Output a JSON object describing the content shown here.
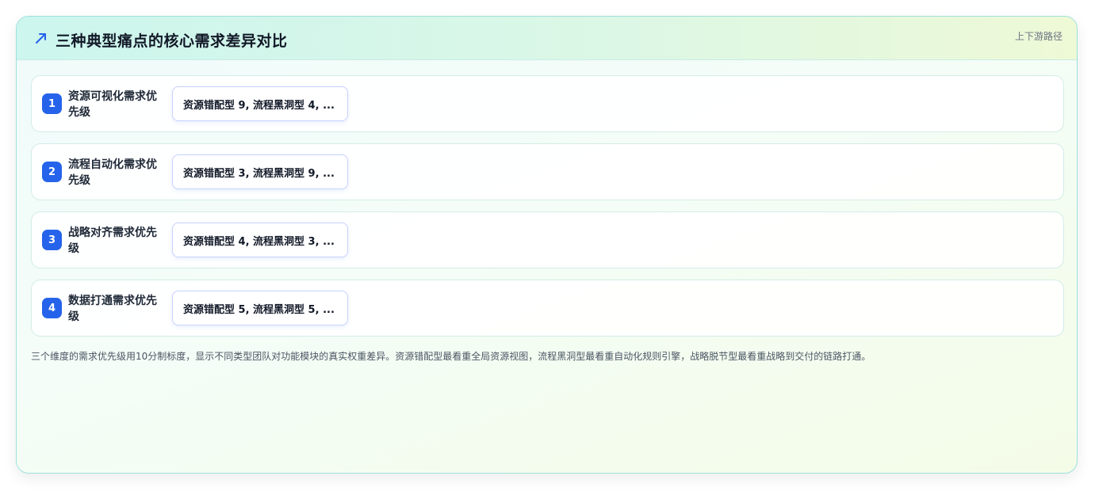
{
  "header": {
    "icon": "trend-arrow-icon",
    "title": "三种典型痛点的核心需求差异对比",
    "subtitle": "上下游路径"
  },
  "colors": {
    "accent": "#2563eb",
    "border": "#9ee0dc"
  },
  "rows": [
    {
      "number": "1",
      "label": "资源可视化需求优先级",
      "value": "资源错配型 9, 流程黑洞型 4, ..."
    },
    {
      "number": "2",
      "label": "流程自动化需求优先级",
      "value": "资源错配型 3, 流程黑洞型 9, ..."
    },
    {
      "number": "3",
      "label": "战略对齐需求优先级",
      "value": "资源错配型 4, 流程黑洞型 3, ..."
    },
    {
      "number": "4",
      "label": "数据打通需求优先级",
      "value": "资源错配型 5, 流程黑洞型 5, ..."
    }
  ],
  "footnote": "三个维度的需求优先级用10分制标度，显示不同类型团队对功能模块的真实权重差异。资源错配型最看重全局资源视图，流程黑洞型最看重自动化规则引擎，战略脱节型最看重战略到交付的链路打通。"
}
